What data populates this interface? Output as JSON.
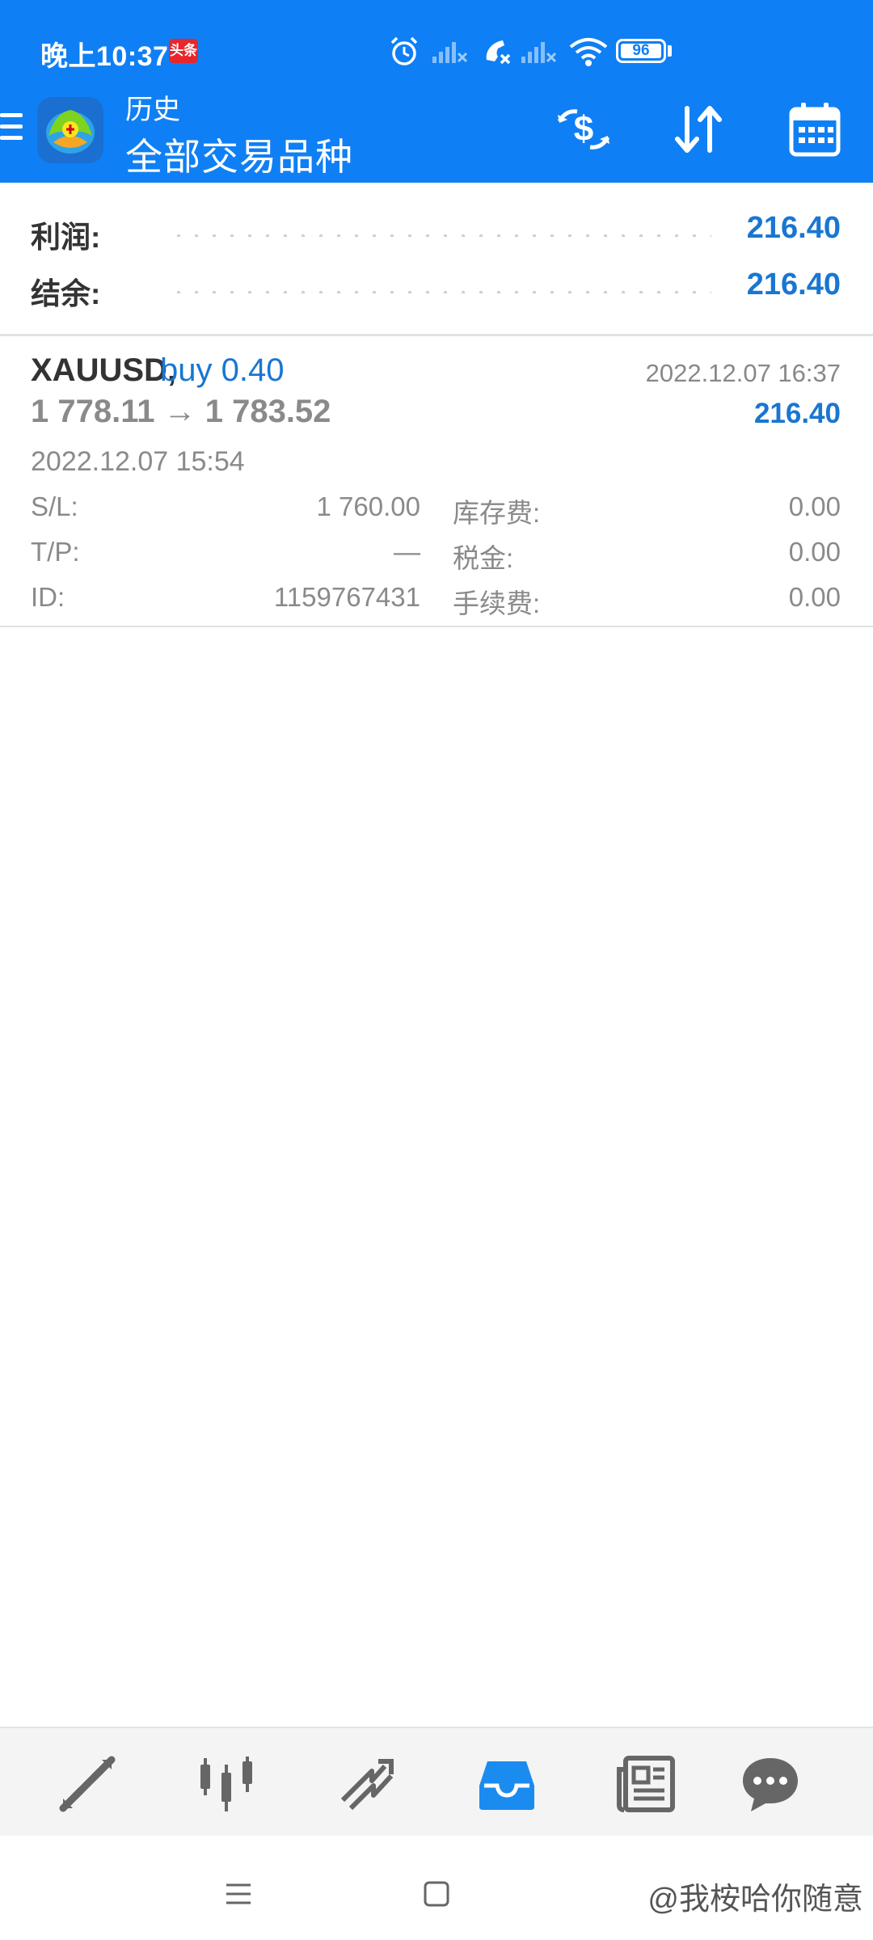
{
  "status_bar": {
    "time": "晚上10:37",
    "badge": "头条",
    "battery": "96",
    "icons": [
      "alarm-icon",
      "signal-icon",
      "call-missed-icon",
      "signal-icon",
      "wifi-icon",
      "battery-icon"
    ]
  },
  "app_bar": {
    "subtitle": "历史",
    "title": "全部交易品种",
    "actions": [
      "currency-exchange-icon",
      "sort-icon",
      "calendar-icon"
    ],
    "accent": "#0f7ff5"
  },
  "summary": {
    "profit_label": "利润:",
    "profit_value": "216.40",
    "balance_label": "结余:",
    "balance_value": "216.40"
  },
  "deal": {
    "symbol": "XAUUSD,",
    "type": "buy 0.40",
    "close_time": "2022.12.07 16:37",
    "prices": "1 778.11 → 1 783.52",
    "profit": "216.40",
    "open_time": "2022.12.07 15:54",
    "sl_label": "S/L:",
    "sl_value": "1 760.00",
    "tp_label": "T/P:",
    "tp_value": "—",
    "id_label": "ID:",
    "id_value": "1159767431",
    "swap_label": "库存费:",
    "swap_value": "0.00",
    "tax_label": "税金:",
    "tax_value": "0.00",
    "commission_label": "手续费:",
    "commission_value": "0.00"
  },
  "bottom_nav": {
    "items": [
      "quotes-icon",
      "chart-icon",
      "trade-icon",
      "history-icon",
      "news-icon",
      "messages-icon"
    ],
    "active": "history-icon",
    "active_color": "#1a8cf0"
  },
  "system_nav": {
    "watermark": "@我桉哈你随意"
  }
}
